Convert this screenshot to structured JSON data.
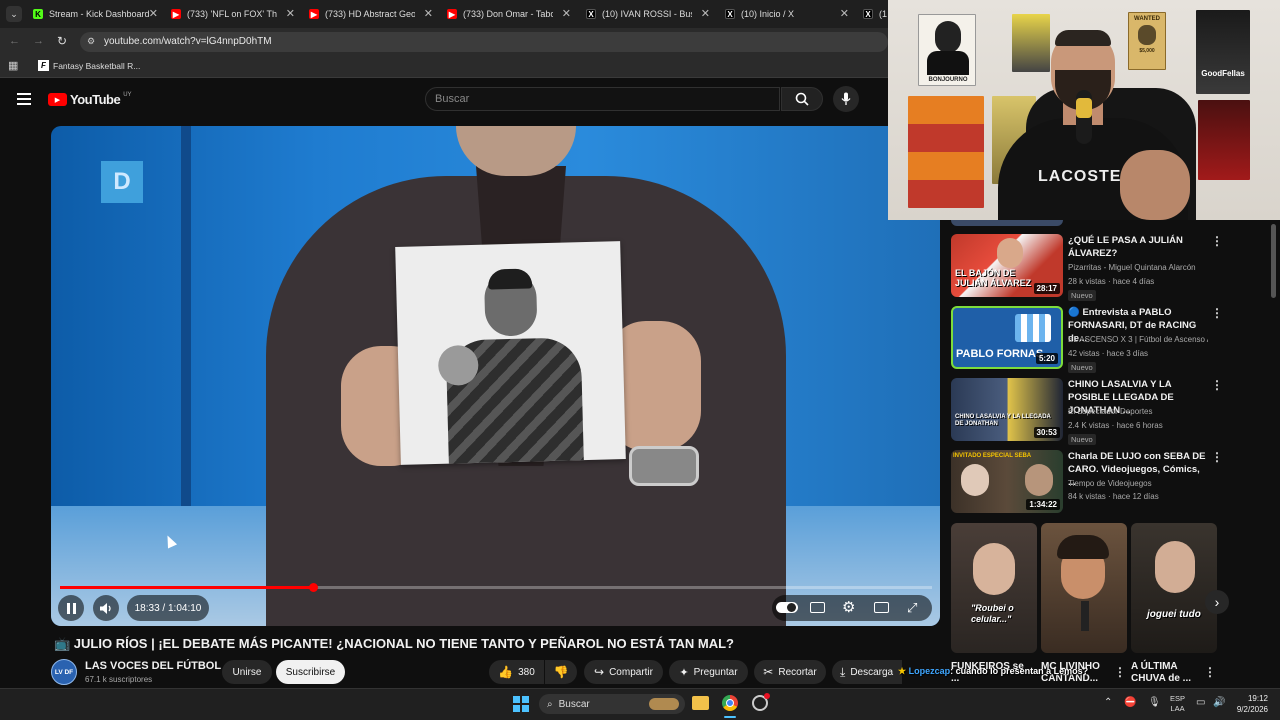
{
  "browser": {
    "tabs": [
      {
        "label": "Stream - Kick Dashboard",
        "fav": "K",
        "color": "#53fc18"
      },
      {
        "label": "(733) 'NFL on FOX' Theme",
        "fav": "▶",
        "color": "#ff0000"
      },
      {
        "label": "(733) HD Abstract Geome",
        "fav": "▶",
        "color": "#ff0000"
      },
      {
        "label": "(733) Don Omar - Taboo",
        "fav": "▶",
        "color": "#ff0000"
      },
      {
        "label": "(10) IVAN ROSSI - Buscar",
        "fav": "X",
        "color": "#000000"
      },
      {
        "label": "(10) Inicio / X",
        "fav": "X",
        "color": "#000000"
      },
      {
        "label": "(1",
        "fav": "X",
        "color": "#000000"
      }
    ],
    "url": "youtube.com/watch?v=lG4nnpD0hTM",
    "bookmark": "Fantasy Basketball R..."
  },
  "youtube": {
    "logo": "YouTube",
    "country": "UY",
    "search_placeholder": "Buscar",
    "player": {
      "channel_badge": "D",
      "time": "18:33 / 1:04:10",
      "progress": 0.29
    },
    "video": {
      "title": "📺 JULIO RÍOS | ¡EL DEBATE MÁS PICANTE! ¿NACIONAL NO TIENE TANTO Y PEÑAROL NO ESTÁ TAN MAL?",
      "channel": "LAS VOCES DEL FÚTBOL",
      "channel_initials": "LV DF",
      "subscribers": "67.1 k suscriptores",
      "join": "Unirse",
      "subscribe": "Suscribirse",
      "likes": "380",
      "share": "Compartir",
      "ask": "Preguntar",
      "clip": "Recortar",
      "download": "Descarga"
    },
    "sidebar": [
      {
        "title": "¿QUÉ LE PASA A JULIÁN ÁLVAREZ?",
        "channel": "Pizarritas - Miguel Quintana Alarcón",
        "meta": "28 k vistas · hace 4 días",
        "duration": "28:17",
        "badge": "Nuevo",
        "thumb_text": "EL BAJÓN DE JULIÁN ÁLVAREZ"
      },
      {
        "title": "🔵 Entrevista a PABLO FORNASARI, DT de RACING de...",
        "channel": "EL ASCENSO X 3 | Fútbol de Ascenso Ar...",
        "meta": "42 vistas · hace 3 días",
        "duration": "5:20",
        "badge": "Nuevo",
        "thumb_text": "PABLO FORNAS"
      },
      {
        "title": "CHINO LASALVIA Y LA POSIBLE LLEGADA DE JONATHAN ...",
        "channel": "El Espectador Deportes",
        "meta": "2.4 K vistas · hace 6 horas",
        "duration": "30:53",
        "badge": "Nuevo",
        "thumb_text": "CHINO LASALVIA Y LA LLEGADA DE JONATHAN"
      },
      {
        "title": "Charla DE LUJO con SEBA DE CARO. Videojuegos, Cómics, ...",
        "channel": "Tiempo de Videojuegos",
        "meta": "84 k vistas · hace 12 días",
        "duration": "1:34:22",
        "badge": "",
        "thumb_text": "INVITADO ESPECIAL SEBA"
      }
    ],
    "shorts": [
      {
        "caption": "FUNKEIROS se ...",
        "overlay": "\"Roubei o celular...\""
      },
      {
        "caption": "MC LIVINHO CANTAND...",
        "overlay": ""
      },
      {
        "caption": "A ÚLTIMA CHUVA de ...",
        "overlay": "joguei tudo"
      }
    ],
    "chat_overlay": {
      "user": "Lopezcap",
      "message": "cuando lo presentan a Lemos?"
    }
  },
  "taskbar": {
    "search": "Buscar",
    "lang_top": "ESP",
    "lang_bottom": "LAA",
    "time": "19:12",
    "date": "9/2/2026"
  },
  "webcam": {
    "poster_left": "BONJOURNO",
    "poster_wanted": "WANTED",
    "poster_wanted_price": "$5,000",
    "poster_goodfellas": "GoodFellas",
    "shirt": "LACOSTE"
  }
}
